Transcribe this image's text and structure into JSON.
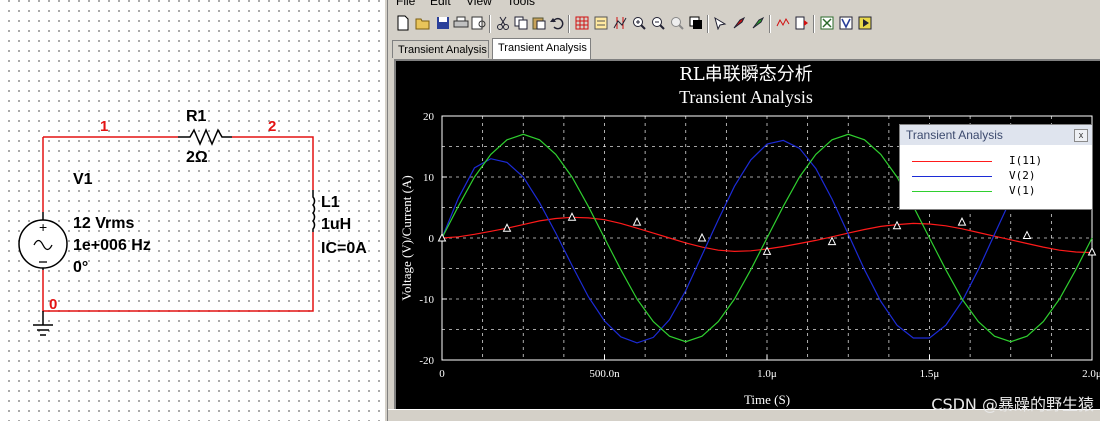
{
  "schematic": {
    "nodes": [
      "1",
      "2",
      "0"
    ],
    "resistor": {
      "ref": "R1",
      "value": "2Ω"
    },
    "inductor": {
      "ref": "L1",
      "value": "1uH",
      "ic": "IC=0A"
    },
    "source": {
      "ref": "V1",
      "amplitude": "12 Vrms",
      "frequency": "1e+006 Hz",
      "phase": "0°"
    },
    "colors": {
      "wire": "#e31212",
      "component": "#000000"
    }
  },
  "grapher": {
    "menu": [
      "File",
      "Edit",
      "View",
      "Tools"
    ],
    "toolbar_icons": [
      "new-icon",
      "open-icon",
      "save-icon",
      "print-icon",
      "print-preview-icon",
      "cut-icon",
      "copy-icon",
      "paste-icon",
      "undo-icon",
      "grid-icon",
      "legend-icon",
      "cursors-icon",
      "zoom-in-icon",
      "zoom-out-icon",
      "zoom-full-icon",
      "reverse-colors-icon",
      "select-trace-icon",
      "properties-icon",
      "add-trace-icon",
      "overlay-icon",
      "export-icon",
      "excel-icon",
      "labview-icon",
      "run-icon"
    ],
    "tabs": [
      {
        "label": "Transient Analysis",
        "active": false
      },
      {
        "label": "Transient Analysis",
        "active": true
      }
    ],
    "legend_title": "Transient Analysis",
    "legend_close": "x",
    "colors": {
      "background": "#000000",
      "grid": "#ffffff",
      "text": "#ffffff"
    }
  },
  "watermark": "CSDN @暴躁的野生猿",
  "chart_data": {
    "type": "line",
    "title": "RL串联瞬态分析",
    "subtitle": "Transient Analysis",
    "xlabel": "Time (S)",
    "ylabel": "Voltage (V)/Current (A)",
    "xlim": [
      0,
      2e-06
    ],
    "ylim": [
      -20,
      20
    ],
    "xticks": [
      0,
      5e-07,
      1e-06,
      1.5e-06,
      2e-06
    ],
    "xtick_labels": [
      "0",
      "500.0n",
      "1.0μ",
      "1.5μ",
      "2.0μ"
    ],
    "yticks": [
      -20,
      -10,
      0,
      10,
      20
    ],
    "ytick_labels": [
      "-20",
      "-10",
      "0",
      "10",
      "20"
    ],
    "grid": true,
    "legend_position": "top-right",
    "series": [
      {
        "name": "I(11)",
        "color": "#ff1a1a",
        "marker": "triangle",
        "x": [
          0,
          5e-08,
          1e-07,
          1.5e-07,
          2e-07,
          2.5e-07,
          3e-07,
          3.5e-07,
          4e-07,
          4.5e-07,
          5e-07,
          5.5e-07,
          6e-07,
          6.5e-07,
          7e-07,
          7.5e-07,
          8e-07,
          8.5e-07,
          9e-07,
          9.5e-07,
          1e-06,
          1.05e-06,
          1.1e-06,
          1.15e-06,
          1.2e-06,
          1.25e-06,
          1.3e-06,
          1.35e-06,
          1.4e-06,
          1.45e-06,
          1.5e-06,
          1.55e-06,
          1.6e-06,
          1.65e-06,
          1.7e-06,
          1.75e-06,
          1.8e-06,
          1.85e-06,
          1.9e-06,
          1.95e-06,
          2e-06
        ],
        "y": [
          0,
          0.2,
          0.6,
          1.1,
          1.6,
          2.2,
          2.8,
          3.2,
          3.4,
          3.3,
          3.0,
          2.4,
          1.6,
          0.8,
          0.0,
          -0.8,
          -1.5,
          -2.0,
          -2.2,
          -2.1,
          -1.8,
          -1.4,
          -0.9,
          -0.4,
          0.2,
          0.8,
          1.4,
          1.9,
          2.2,
          2.4,
          2.3,
          2.0,
          1.5,
          0.9,
          0.3,
          -0.3,
          -0.9,
          -1.5,
          -2.0,
          -2.3,
          -2.4
        ]
      },
      {
        "name": "V(2)",
        "color": "#1c2bd6",
        "x": [
          0,
          5e-08,
          1e-07,
          1.5e-07,
          2e-07,
          2.5e-07,
          3e-07,
          3.5e-07,
          4e-07,
          4.5e-07,
          5e-07,
          5.5e-07,
          6e-07,
          6.5e-07,
          7e-07,
          7.5e-07,
          8e-07,
          8.5e-07,
          9e-07,
          9.5e-07,
          1e-06,
          1.05e-06,
          1.1e-06,
          1.15e-06,
          1.2e-06,
          1.25e-06,
          1.3e-06,
          1.35e-06,
          1.4e-06,
          1.45e-06,
          1.5e-06,
          1.55e-06,
          1.6e-06,
          1.65e-06,
          1.7e-06,
          1.75e-06,
          1.8e-06,
          1.85e-06,
          1.9e-06,
          1.95e-06,
          2e-06
        ],
        "y": [
          0,
          6.5,
          11.5,
          13.0,
          12.4,
          10.0,
          5.8,
          0.8,
          -4.5,
          -9.6,
          -13.6,
          -16.2,
          -17.2,
          -16.3,
          -13.4,
          -8.6,
          -2.8,
          3.0,
          8.5,
          12.8,
          15.4,
          16.0,
          14.7,
          11.4,
          6.4,
          0.6,
          -5.2,
          -10.4,
          -14.3,
          -16.4,
          -16.4,
          -14.3,
          -10.4,
          -5.2,
          0.6,
          6.4,
          11.4,
          14.7,
          16.0,
          15.4,
          12.8
        ]
      },
      {
        "name": "V(1)",
        "color": "#2fcf2f",
        "x": [
          0,
          5e-08,
          1e-07,
          1.5e-07,
          2e-07,
          2.5e-07,
          3e-07,
          3.5e-07,
          4e-07,
          4.5e-07,
          5e-07,
          5.5e-07,
          6e-07,
          6.5e-07,
          7e-07,
          7.5e-07,
          8e-07,
          8.5e-07,
          9e-07,
          9.5e-07,
          1e-06,
          1.05e-06,
          1.1e-06,
          1.15e-06,
          1.2e-06,
          1.25e-06,
          1.3e-06,
          1.35e-06,
          1.4e-06,
          1.45e-06,
          1.5e-06,
          1.55e-06,
          1.6e-06,
          1.65e-06,
          1.7e-06,
          1.75e-06,
          1.8e-06,
          1.85e-06,
          1.9e-06,
          1.95e-06,
          2e-06
        ],
        "y": [
          0,
          5.2,
          10.0,
          13.7,
          16.1,
          17.0,
          16.1,
          13.7,
          10.0,
          5.2,
          0.0,
          -5.2,
          -10.0,
          -13.7,
          -16.1,
          -17.0,
          -16.1,
          -13.7,
          -10.0,
          -5.2,
          0.0,
          5.2,
          10.0,
          13.7,
          16.1,
          17.0,
          16.1,
          13.7,
          10.0,
          5.2,
          0.0,
          -5.2,
          -10.0,
          -13.7,
          -16.1,
          -17.0,
          -16.1,
          -13.7,
          -10.0,
          -5.2,
          0.0
        ]
      }
    ],
    "marker_points": {
      "x": [
        0,
        2e-07,
        4e-07,
        6e-07,
        8e-07,
        1e-06,
        1.2e-06,
        1.4e-06,
        1.6e-06,
        1.8e-06,
        2e-06
      ],
      "y": [
        0,
        1.6,
        3.4,
        2.6,
        0.0,
        -2.2,
        -0.6,
        2.0,
        2.6,
        0.4,
        -2.3
      ]
    }
  }
}
